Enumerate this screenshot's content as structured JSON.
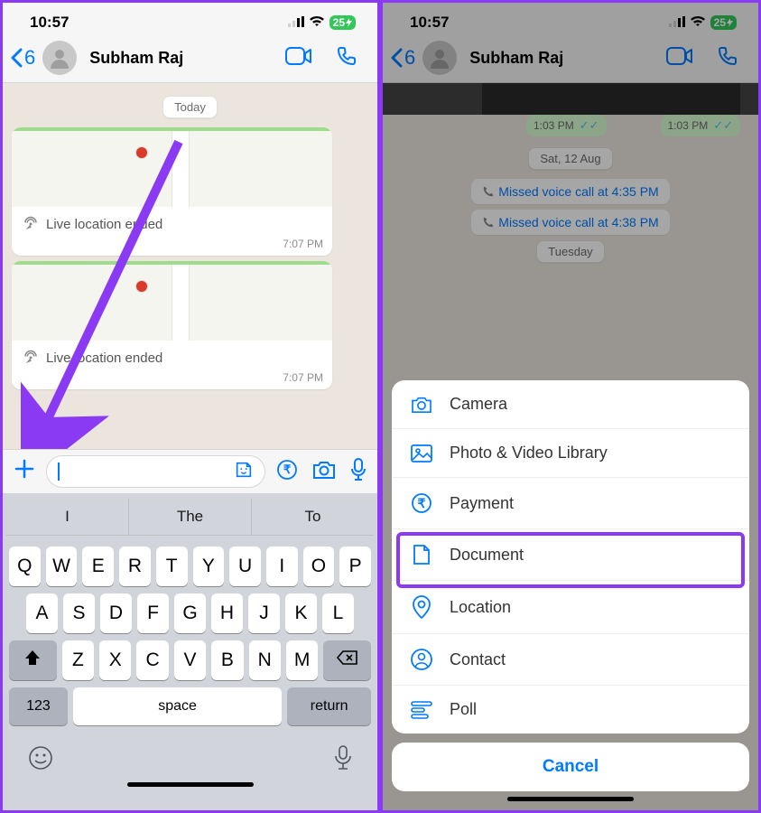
{
  "status": {
    "time": "10:57",
    "battery": "25"
  },
  "chat": {
    "back_count": "6",
    "contact_name": "Subham Raj",
    "today_label": "Today",
    "live_location_ended": "Live location ended",
    "time1": "7:07 PM",
    "time2": "7:07 PM"
  },
  "keyboard": {
    "suggest1": "I",
    "suggest2": "The",
    "suggest3": "To",
    "row1": [
      "Q",
      "W",
      "E",
      "R",
      "T",
      "Y",
      "U",
      "I",
      "O",
      "P"
    ],
    "row2": [
      "A",
      "S",
      "D",
      "F",
      "G",
      "H",
      "J",
      "K",
      "L"
    ],
    "row3": [
      "Z",
      "X",
      "C",
      "V",
      "B",
      "N",
      "M"
    ],
    "num": "123",
    "space": "space",
    "return": "return"
  },
  "screenB": {
    "sent_time": "1:03 PM",
    "sat_label": "Sat, 12 Aug",
    "missed1": "Missed voice call at 4:35 PM",
    "missed2": "Missed voice call at 4:38 PM",
    "tuesday": "Tuesday"
  },
  "sheet": {
    "items": [
      {
        "label": "Camera",
        "icon": "camera"
      },
      {
        "label": "Photo & Video Library",
        "icon": "image"
      },
      {
        "label": "Payment",
        "icon": "rupee"
      },
      {
        "label": "Document",
        "icon": "document"
      },
      {
        "label": "Location",
        "icon": "location"
      },
      {
        "label": "Contact",
        "icon": "contact"
      },
      {
        "label": "Poll",
        "icon": "poll"
      }
    ],
    "cancel": "Cancel"
  }
}
